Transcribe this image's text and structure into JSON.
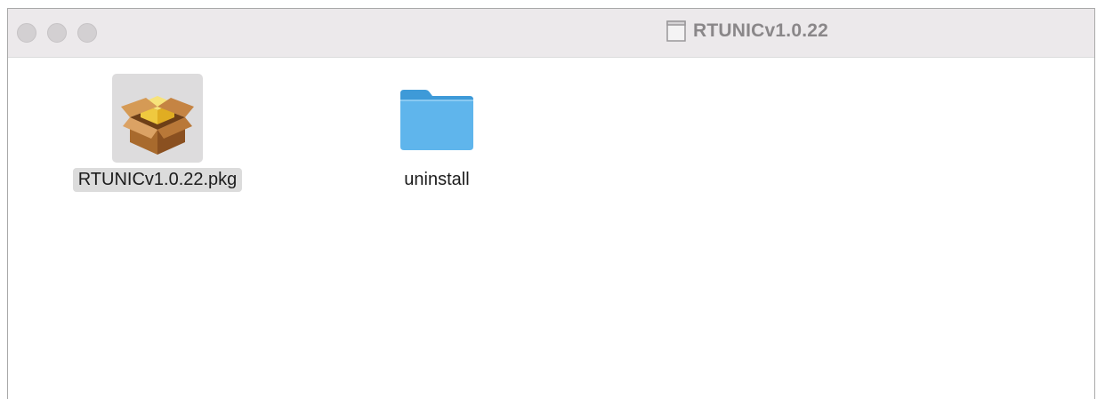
{
  "window": {
    "title": "RTUNICv1.0.22",
    "title_icon": "document-icon"
  },
  "files": [
    {
      "name": "RTUNICv1.0.22.pkg",
      "icon": "package-icon",
      "selected": true
    },
    {
      "name": "uninstall",
      "icon": "folder-icon",
      "selected": false
    }
  ],
  "colors": {
    "folder": "#5fb5ec",
    "folder_tab": "#3e9ad8",
    "titlebar": "#ece9eb",
    "selection": "#dcdcdc"
  }
}
